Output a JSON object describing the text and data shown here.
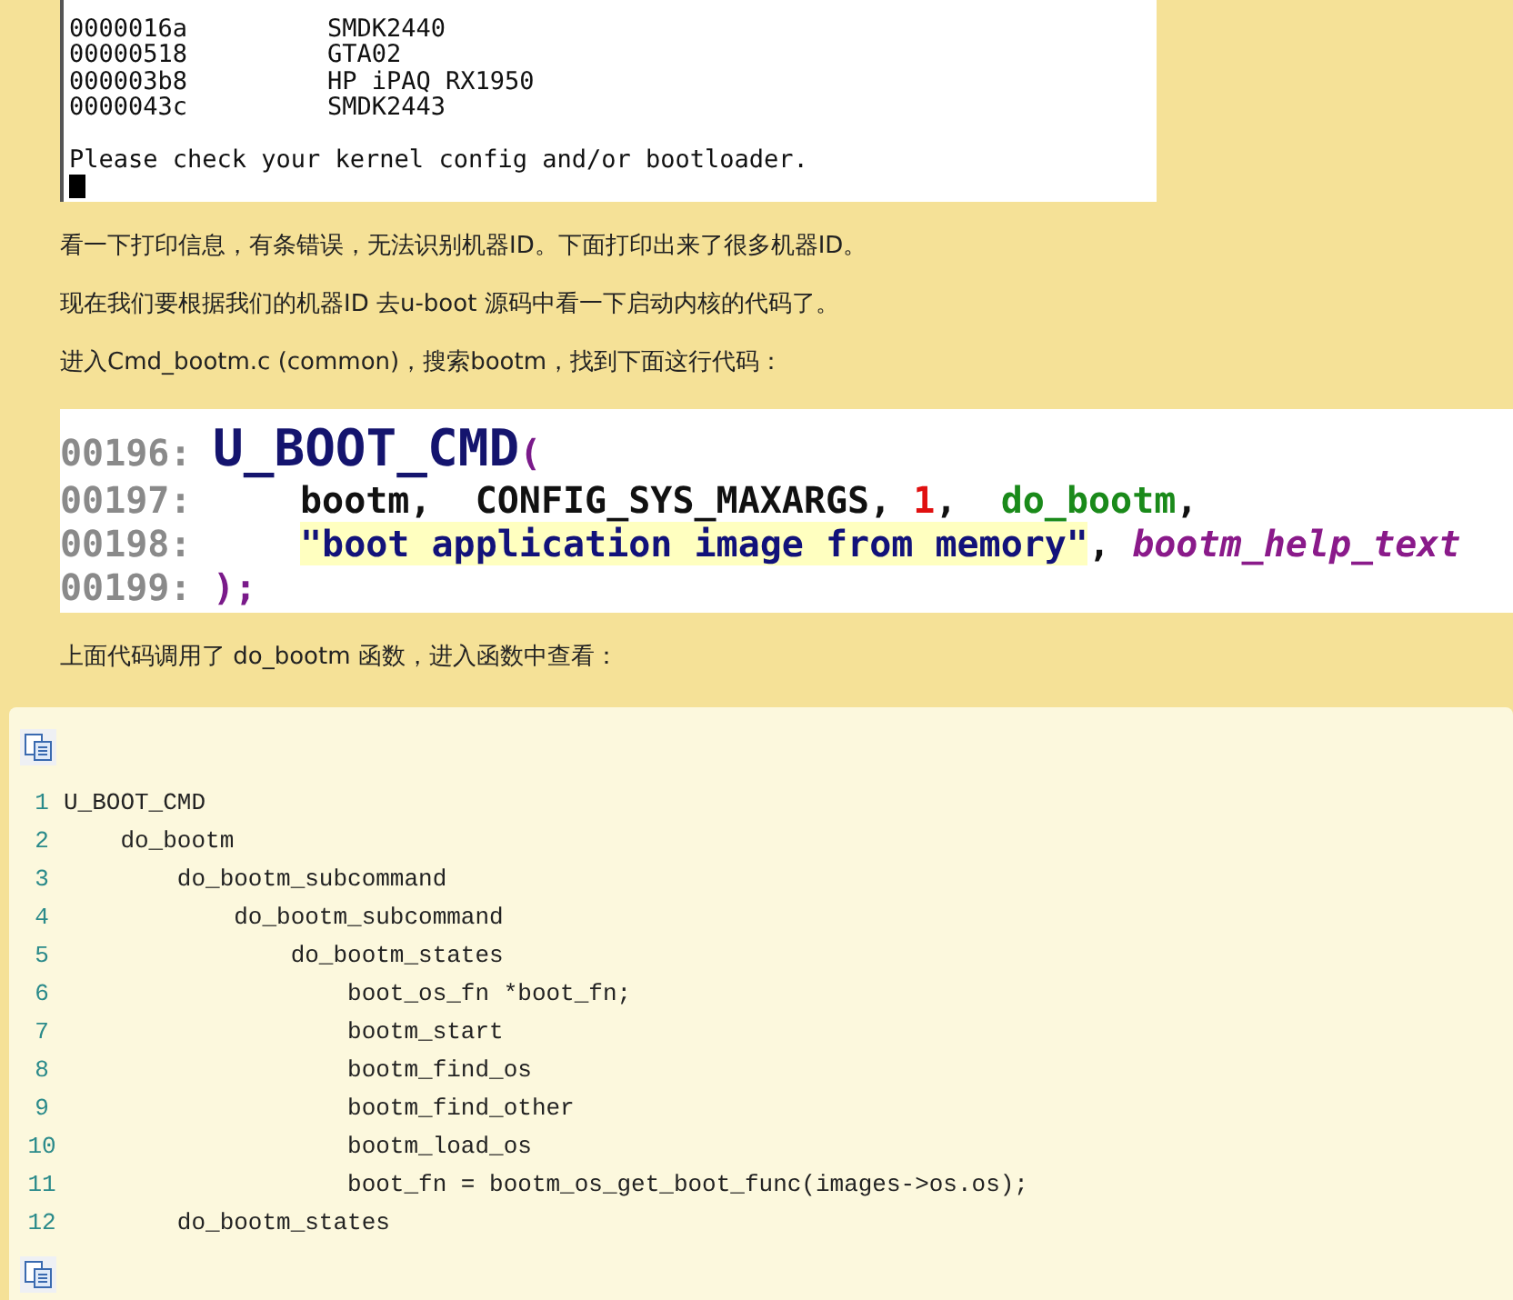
{
  "terminal": {
    "rows": [
      {
        "code": "0000016a",
        "name": "SMDK2440"
      },
      {
        "code": "00000518",
        "name": "GTA02"
      },
      {
        "code": "000003b8",
        "name": "HP iPAQ RX1950"
      },
      {
        "code": "0000043c",
        "name": "SMDK2443"
      }
    ],
    "message": "Please check your kernel config and/or bootloader."
  },
  "paragraphs_before": [
    "看一下打印信息，有条错误，无法识别机器ID。下面打印出来了很多机器ID。",
    "现在我们要根据我们的机器ID 去u-boot 源码中看一下启动内核的代码了。",
    "进入Cmd_bootm.c (common)，搜索bootm，找到下面这行代码："
  ],
  "code_image": {
    "lines": [
      {
        "number": "00196:",
        "indent": false,
        "tokens": [
          {
            "kind": "macro",
            "text": "U_BOOT_CMD"
          },
          {
            "kind": "punct",
            "text": "("
          }
        ]
      },
      {
        "number": "00197:",
        "indent": true,
        "tokens": [
          {
            "kind": "plain",
            "text": "bootm,  CONFIG_SYS_MAXARGS, "
          },
          {
            "kind": "number",
            "text": "1"
          },
          {
            "kind": "plain",
            "text": ",  "
          },
          {
            "kind": "func",
            "text": "do_bootm"
          },
          {
            "kind": "plain",
            "text": ","
          }
        ]
      },
      {
        "number": "00198:",
        "indent": true,
        "tokens": [
          {
            "kind": "string",
            "text": "\"boot application image from memory\""
          },
          {
            "kind": "plain",
            "text": ", "
          },
          {
            "kind": "ident",
            "text": "bootm_help_text"
          }
        ]
      },
      {
        "number": "00199:",
        "indent": false,
        "tokens": [
          {
            "kind": "punct",
            "text": ");"
          }
        ]
      }
    ]
  },
  "paragraphs_after": [
    "上面代码调用了 do_bootm 函数，进入函数中查看："
  ],
  "listing": {
    "lines": [
      {
        "number": "1",
        "code": "U_BOOT_CMD"
      },
      {
        "number": "2",
        "code": "    do_bootm"
      },
      {
        "number": "3",
        "code": "        do_bootm_subcommand"
      },
      {
        "number": "4",
        "code": "            do_bootm_subcommand"
      },
      {
        "number": "5",
        "code": "                do_bootm_states"
      },
      {
        "number": "6",
        "code": "                    boot_os_fn *boot_fn;"
      },
      {
        "number": "7",
        "code": "                    bootm_start"
      },
      {
        "number": "8",
        "code": "                    bootm_find_os"
      },
      {
        "number": "9",
        "code": "                    bootm_find_other"
      },
      {
        "number": "10",
        "code": "                    bootm_load_os"
      },
      {
        "number": "11",
        "code": "                    boot_fn = bootm_os_get_boot_func(images->os.os);"
      },
      {
        "number": "12",
        "code": "        do_bootm_states"
      }
    ]
  }
}
